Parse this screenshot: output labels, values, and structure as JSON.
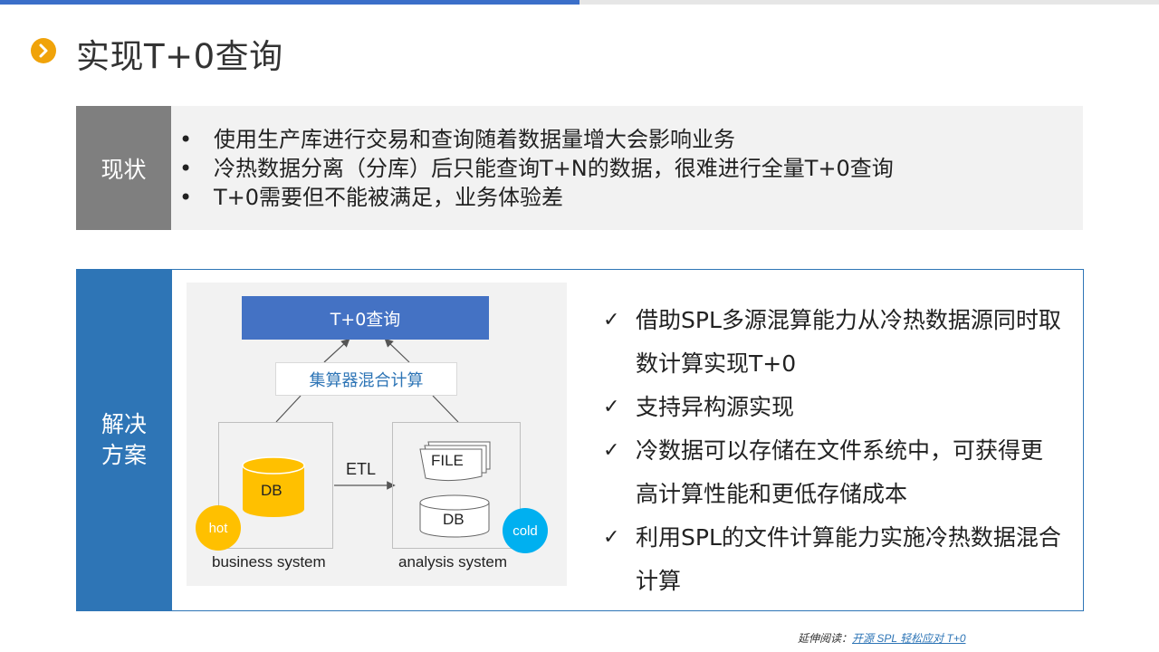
{
  "title": "实现T+0查询",
  "status": {
    "label": "现状",
    "bullet": "•",
    "items": [
      "使用生产库进行交易和查询随着数据量增大会影响业务",
      "冷热数据分离（分库）后只能查询T+N的数据，很难进行全量T+0查询",
      "T+0需要但不能被满足，业务体验差"
    ]
  },
  "solution": {
    "label": "解决方案",
    "check_mark": "✓",
    "items": [
      "借助SPL多源混算能力从冷热数据源同时取数计算实现T+0",
      "支持异构源实现",
      "冷数据可以存储在文件系统中，可获得更高计算性能和更低存储成本",
      "利用SPL的文件计算能力实施冷热数据混合计算"
    ]
  },
  "diagram": {
    "query_box": "T+0查询",
    "compute_box": "集算器混合计算",
    "etl": "ETL",
    "hot_db": "DB",
    "cold_file": "FILE",
    "cold_db": "DB",
    "hot_badge": "hot",
    "cold_badge": "cold",
    "left_caption": "business system",
    "right_caption": "analysis system",
    "colors": {
      "query": "#4472c4",
      "hot_db": "#ffc000",
      "hot": "#ffc000",
      "cold": "#00b0f0"
    }
  },
  "footer": {
    "prefix": "延伸阅读：",
    "link": "开源 SPL 轻松应对 T+0"
  }
}
